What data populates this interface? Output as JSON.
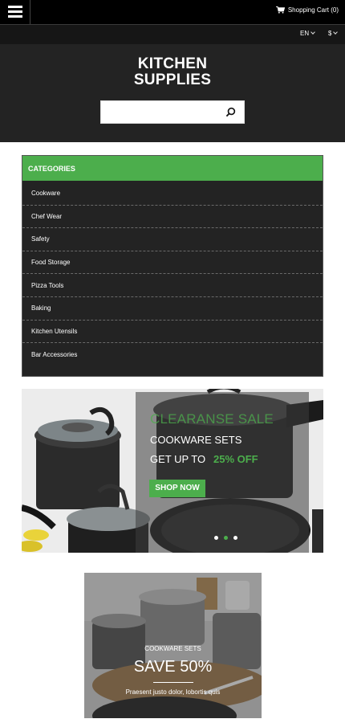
{
  "topbar": {
    "cart_label": "Shopping Cart (0)"
  },
  "langbar": {
    "language": "EN",
    "currency": "$"
  },
  "header": {
    "logo_line1": "KITCHEN",
    "logo_line2": "SUPPLIES",
    "search_placeholder": "",
    "search_value": ""
  },
  "categories": {
    "title": "CATEGORIES",
    "items": [
      {
        "label": "Cookware"
      },
      {
        "label": "Chef Wear"
      },
      {
        "label": "Safety"
      },
      {
        "label": "Food Storage"
      },
      {
        "label": "Pizza Tools"
      },
      {
        "label": "Baking"
      },
      {
        "label": "Kitchen Utensils"
      },
      {
        "label": "Bar Accessories"
      }
    ]
  },
  "slider": {
    "title": "CLEARANSE SALE",
    "subtitle": "COOKWARE SETS",
    "get_up_to": "GET UP TO",
    "discount": "25% OFF",
    "button": "SHOP NOW",
    "slide_count": 3,
    "active_slide": 2
  },
  "promo": {
    "category": "COOKWARE SETS",
    "headline": "SAVE 50%",
    "text": "Praesent justo dolor, lobortis quis"
  },
  "colors": {
    "accent_green": "#4cae4c",
    "header_dark": "#232323",
    "topbar_black": "#000000"
  }
}
